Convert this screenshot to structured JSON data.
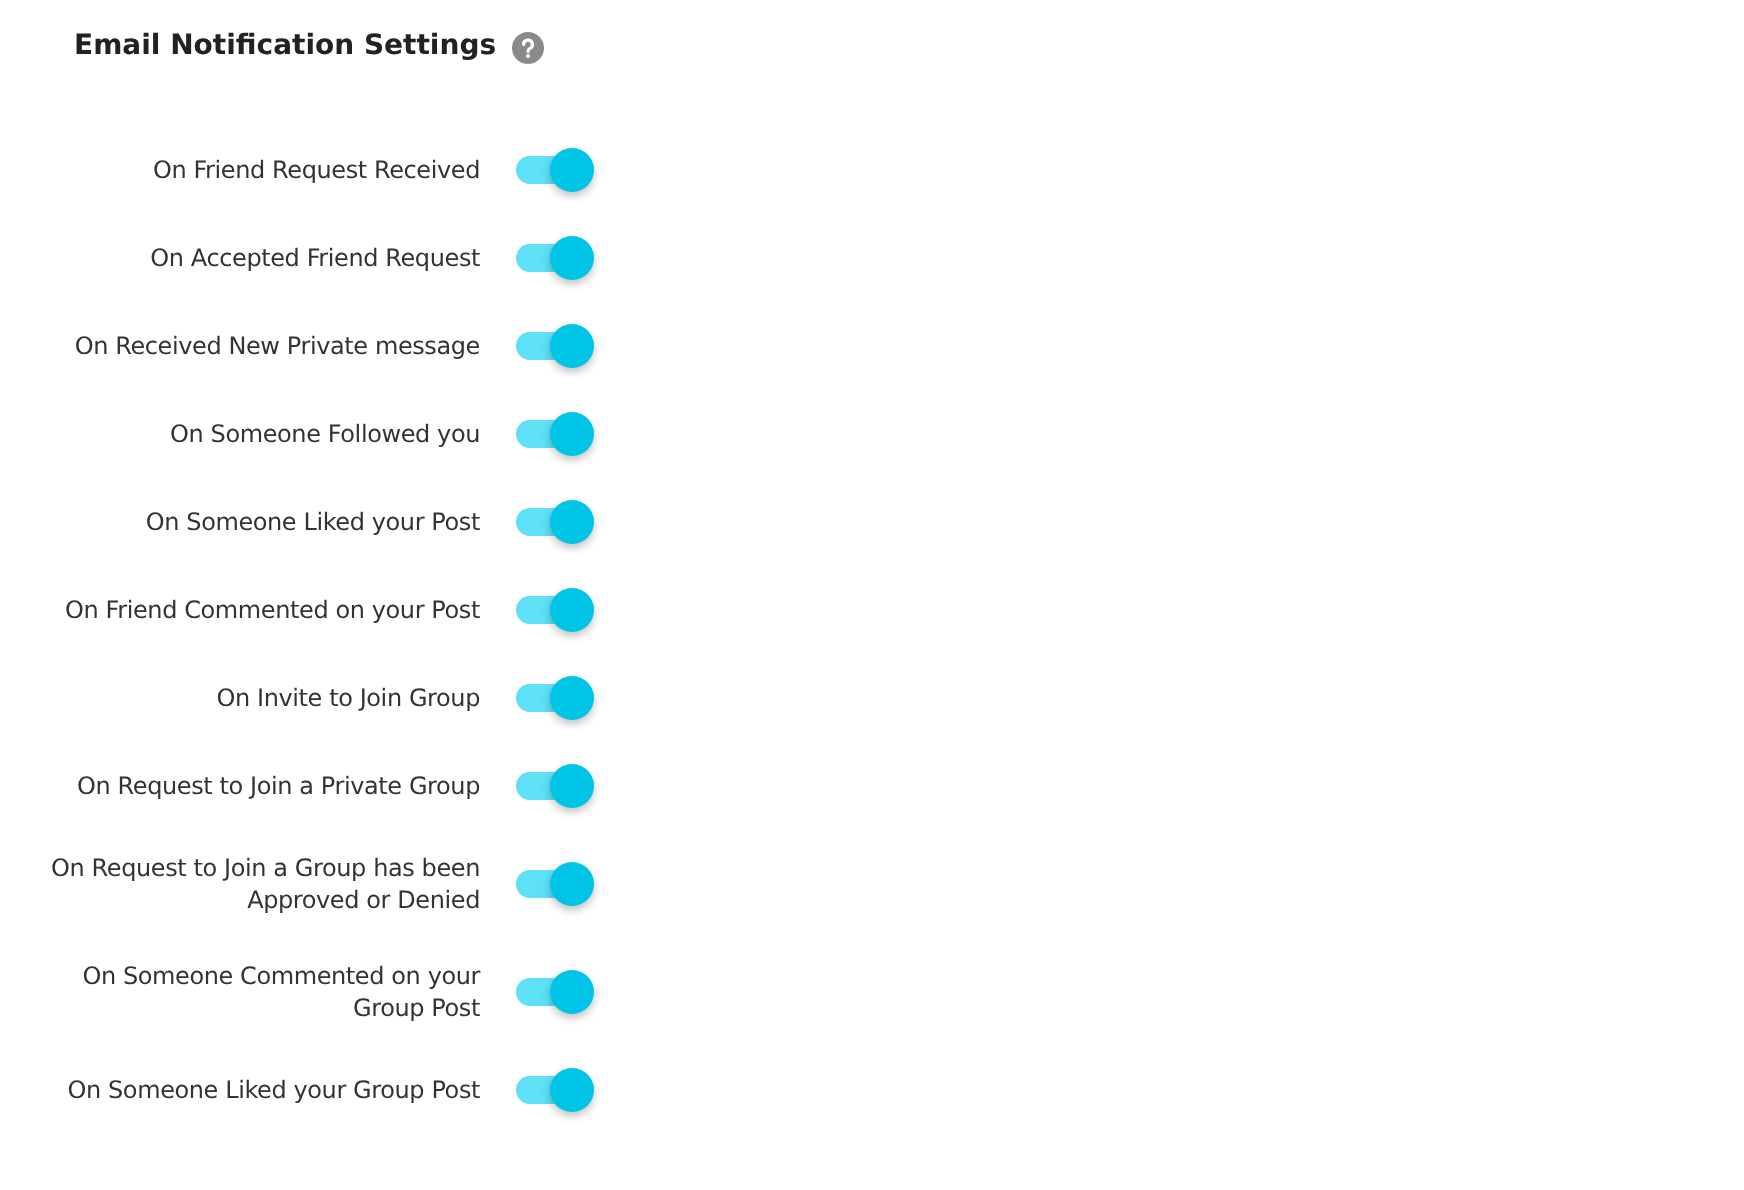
{
  "title": "Email Notification Settings",
  "settings": [
    {
      "label": "On Friend Request Received",
      "on": true
    },
    {
      "label": "On Accepted Friend Request",
      "on": true
    },
    {
      "label": "On Received New Private message",
      "on": true
    },
    {
      "label": "On Someone Followed you",
      "on": true
    },
    {
      "label": "On Someone Liked your Post",
      "on": true
    },
    {
      "label": "On Friend Commented on your Post",
      "on": true
    },
    {
      "label": "On Invite to Join Group",
      "on": true
    },
    {
      "label": "On Request to Join a Private Group",
      "on": true
    },
    {
      "label": "On Request to Join a Group has been Approved or Denied",
      "on": true
    },
    {
      "label": "On Someone Commented on your Group Post",
      "on": true
    },
    {
      "label": "On Someone Liked your Group Post",
      "on": true
    }
  ]
}
